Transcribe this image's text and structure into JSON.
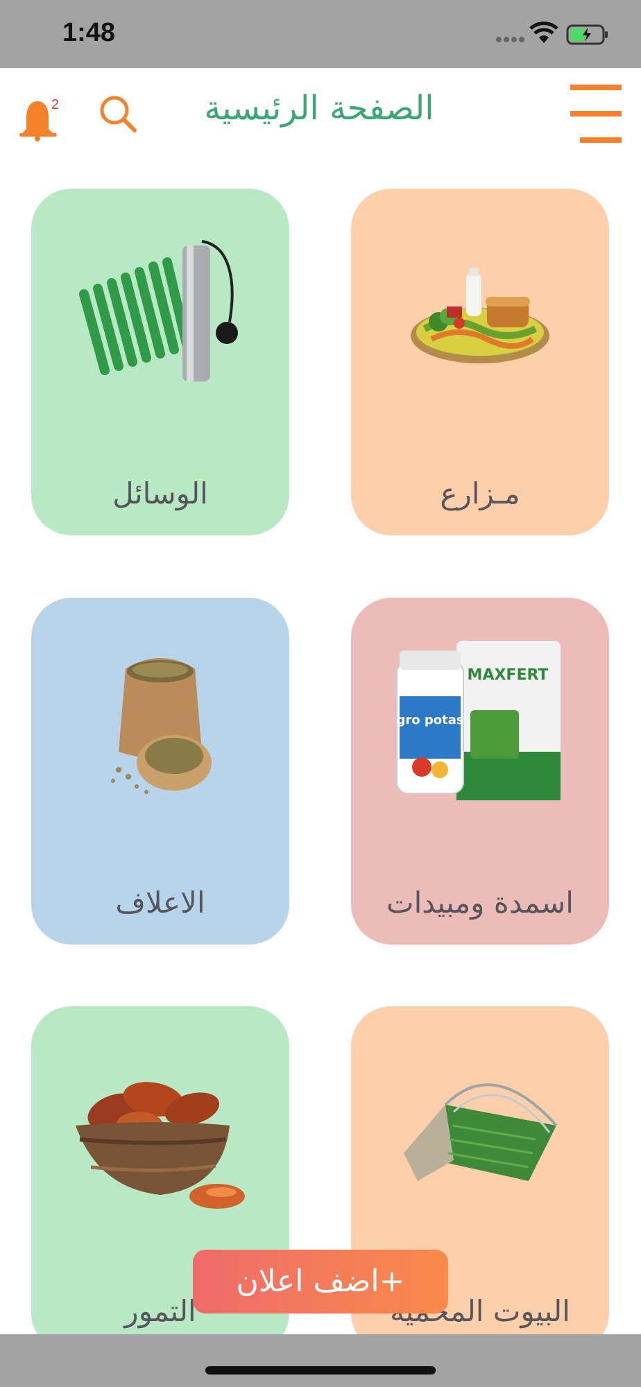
{
  "status_bar": {
    "time": "1:48"
  },
  "header": {
    "title": "الصفحة الرئيسية",
    "notification_count": "2",
    "icons": [
      "bell-icon",
      "search-icon",
      "menu-icon"
    ]
  },
  "categories": [
    {
      "label": "مـزارع",
      "icon": "farm-produce-icon",
      "color": "#fdcfaa"
    },
    {
      "label": "الوسائل",
      "icon": "pipes-pump-icon",
      "color": "#b8e8c4"
    },
    {
      "label": "اسمدة ومبيدات",
      "icon": "fertilizer-bags-icon",
      "color": "#ebbcb8"
    },
    {
      "label": "الاعلاف",
      "icon": "feed-sacks-icon",
      "color": "#b8d4ea"
    },
    {
      "label": "البيوت المحمية",
      "icon": "greenhouse-icon",
      "color": "#fdcfaa"
    },
    {
      "label": "التمور",
      "icon": "dates-bowl-icon",
      "color": "#b8e8c4"
    }
  ],
  "add_ad_button": {
    "label": "+اضف اعلان"
  },
  "colors": {
    "accent_orange": "#f5822a",
    "title_green": "#3aa773",
    "status_gray": "#a3a3a3"
  }
}
